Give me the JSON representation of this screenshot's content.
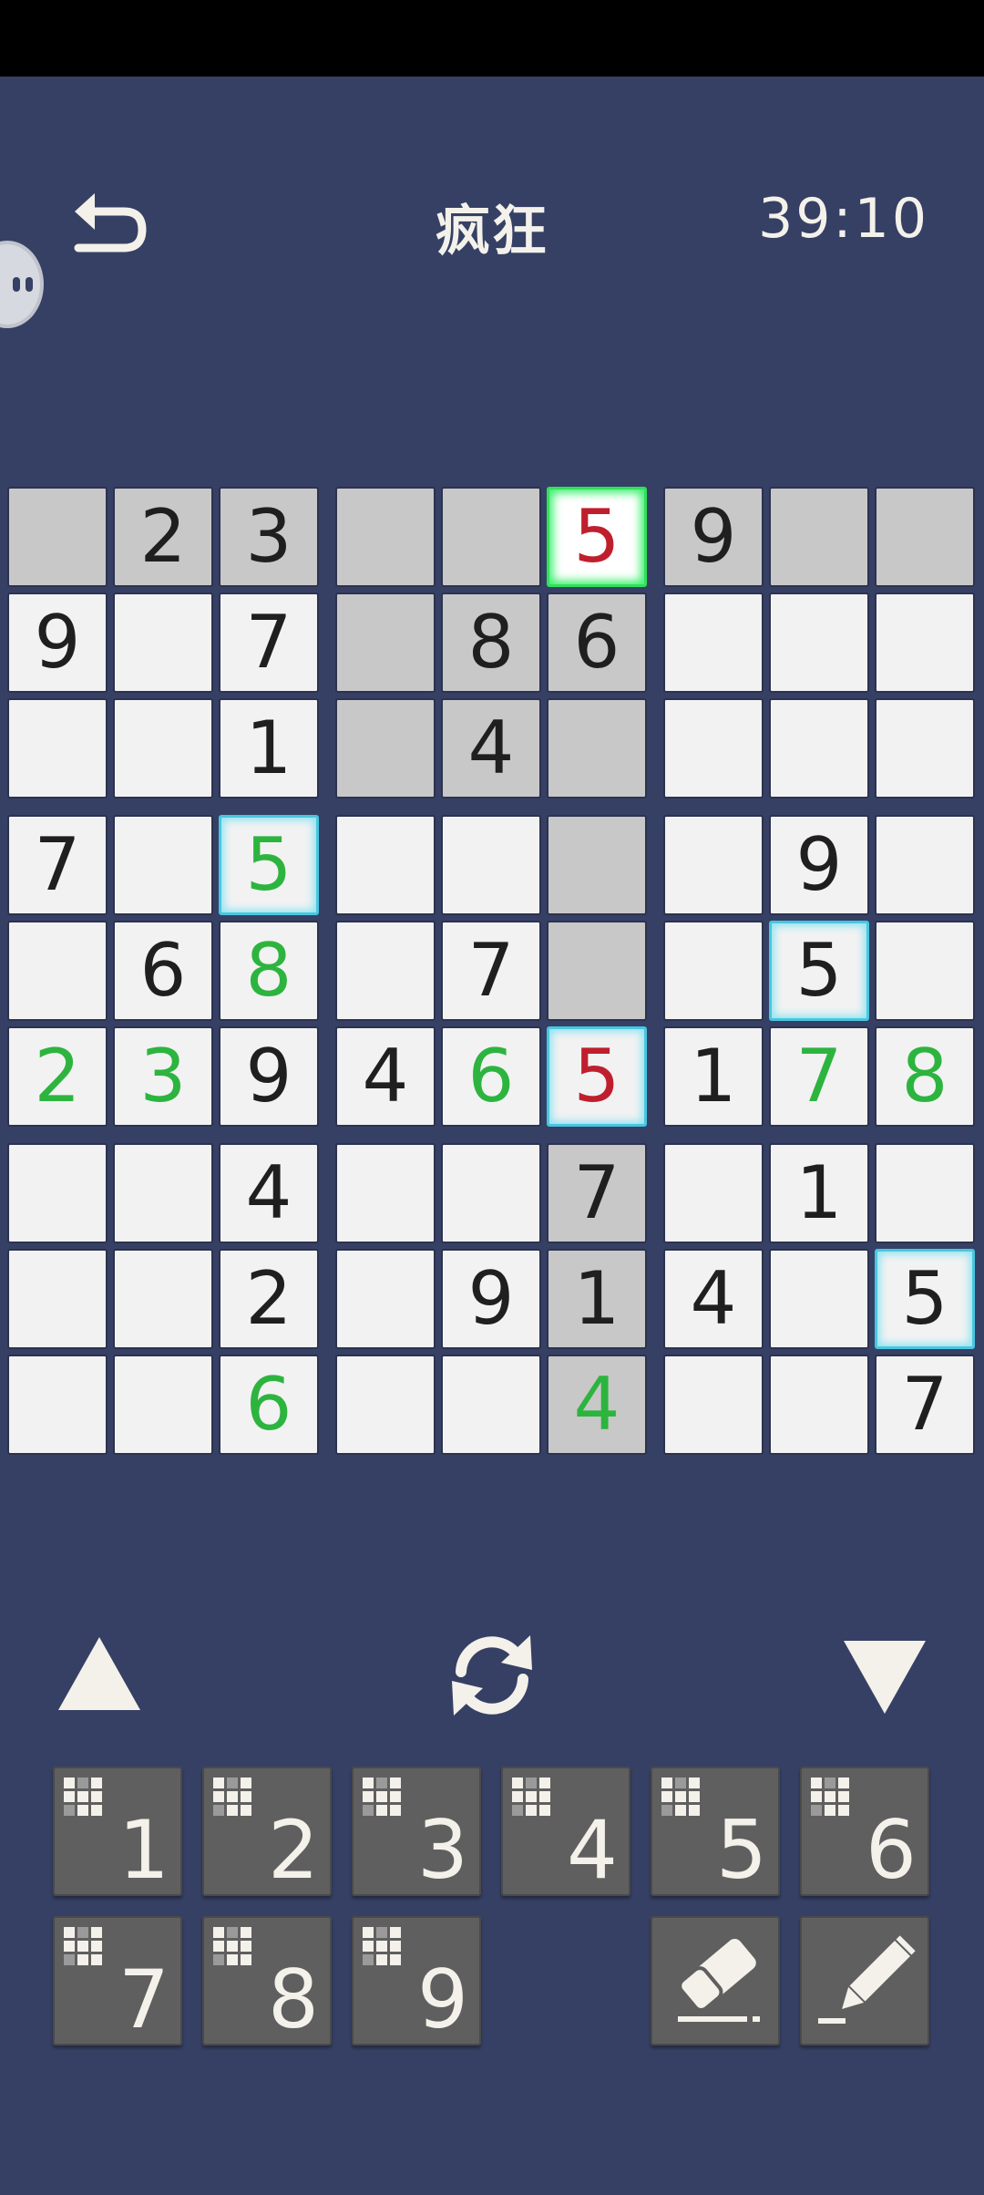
{
  "app": {
    "title": "疯狂",
    "timer": "39:10"
  },
  "colors": {
    "background": "#364064",
    "cell": "#f2f2f2",
    "highlight": "#c8c8c8",
    "user_digit": "#2db43f",
    "error_digit": "#bf1f2d",
    "given_digit": "#1f1f1f",
    "selected_border": "#31e05a",
    "same_number_border": "#49c6e0",
    "button": "#5f5f5f"
  },
  "board": {
    "rows": [
      [
        "",
        "2",
        "3",
        "",
        "",
        "5",
        "9",
        "",
        ""
      ],
      [
        "9",
        "",
        "7",
        "",
        "8",
        "6",
        "",
        "",
        ""
      ],
      [
        "",
        "",
        "1",
        "",
        "4",
        "",
        "",
        "",
        ""
      ],
      [
        "7",
        "",
        "5",
        "",
        "",
        "",
        "",
        "9",
        ""
      ],
      [
        "",
        "6",
        "8",
        "",
        "7",
        "",
        "",
        "5",
        ""
      ],
      [
        "2",
        "3",
        "9",
        "4",
        "6",
        "5",
        "1",
        "7",
        "8"
      ],
      [
        "",
        "",
        "4",
        "",
        "",
        "7",
        "",
        "1",
        ""
      ],
      [
        "",
        "",
        "2",
        "",
        "9",
        "1",
        "4",
        "",
        "5"
      ],
      [
        "",
        "",
        "6",
        "",
        "",
        "4",
        "",
        "",
        "7"
      ]
    ],
    "highlighted": [
      [
        0,
        0
      ],
      [
        0,
        1
      ],
      [
        0,
        2
      ],
      [
        0,
        3
      ],
      [
        0,
        4
      ],
      [
        0,
        6
      ],
      [
        0,
        7
      ],
      [
        0,
        8
      ],
      [
        1,
        3
      ],
      [
        1,
        4
      ],
      [
        1,
        5
      ],
      [
        2,
        3
      ],
      [
        2,
        4
      ],
      [
        2,
        5
      ],
      [
        3,
        5
      ],
      [
        4,
        5
      ],
      [
        6,
        5
      ],
      [
        7,
        5
      ],
      [
        8,
        5
      ]
    ],
    "user_entered": [
      [
        3,
        2
      ],
      [
        4,
        2
      ],
      [
        5,
        0
      ],
      [
        5,
        1
      ],
      [
        5,
        4
      ],
      [
        5,
        7
      ],
      [
        5,
        8
      ],
      [
        8,
        2
      ],
      [
        8,
        5
      ]
    ],
    "error_entered": [
      [
        0,
        5
      ],
      [
        5,
        5
      ]
    ],
    "selected": [
      0,
      5
    ],
    "same_number": [
      [
        3,
        2
      ],
      [
        4,
        7
      ],
      [
        5,
        5
      ],
      [
        7,
        8
      ]
    ]
  },
  "controls": {
    "prev_icon": "triangle-up-icon",
    "refresh_icon": "refresh-icon",
    "next_icon": "triangle-down-icon",
    "number_buttons": [
      "1",
      "2",
      "3",
      "4",
      "5",
      "6",
      "7",
      "8",
      "9"
    ],
    "eraser_icon": "eraser-icon",
    "pencil_icon": "pencil-icon"
  }
}
